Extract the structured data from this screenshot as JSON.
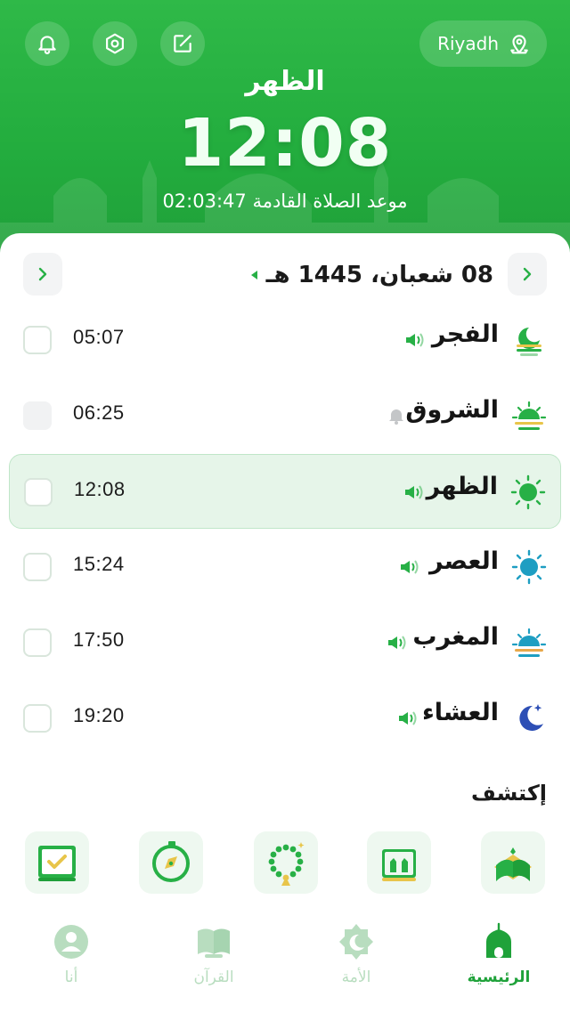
{
  "header": {
    "city": "Riyadh",
    "current_prayer": "الظهر",
    "current_time": "12:08",
    "next_prayer_label": "موعد الصلاة القادمة",
    "next_prayer_countdown": "02:03:47",
    "icons": [
      "bell-icon",
      "settings-icon",
      "edit-icon",
      "location-icon"
    ]
  },
  "date": {
    "hijri": "08 شعبان، 1445 هـ"
  },
  "prayers": [
    {
      "name": "الفجر",
      "time": "05:07",
      "icon": "fajr-icon",
      "alert": "sound",
      "active": false
    },
    {
      "name": "الشروق",
      "time": "06:25",
      "icon": "sunrise-icon",
      "alert": "bell",
      "active": false
    },
    {
      "name": "الظهر",
      "time": "12:08",
      "icon": "dhuhr-sun-icon",
      "alert": "sound",
      "active": true
    },
    {
      "name": "العصر",
      "time": "15:24",
      "icon": "asr-sun-icon",
      "alert": "sound",
      "active": false
    },
    {
      "name": "المغرب",
      "time": "17:50",
      "icon": "sunset-icon",
      "alert": "sound",
      "active": false
    },
    {
      "name": "العشاء",
      "time": "19:20",
      "icon": "moon-icon",
      "alert": "sound",
      "active": false
    }
  ],
  "explore": {
    "title": "إكتشف",
    "tiles": [
      "quran-book-icon",
      "dua-hands-icon",
      "tasbih-icon",
      "qibla-compass-icon",
      "checklist-icon"
    ]
  },
  "bottom_nav": [
    {
      "label": "الرئيسية",
      "icon": "home-mosque-icon",
      "active": true
    },
    {
      "label": "الأمة",
      "icon": "community-icon",
      "active": false
    },
    {
      "label": "القرآن",
      "icon": "quran-icon",
      "active": false
    },
    {
      "label": "أنا",
      "icon": "profile-icon",
      "active": false
    }
  ],
  "colors": {
    "primary": "#27b046",
    "active_row_bg": "#e6f5e9",
    "inactive_tab": "#b8ddbf"
  }
}
